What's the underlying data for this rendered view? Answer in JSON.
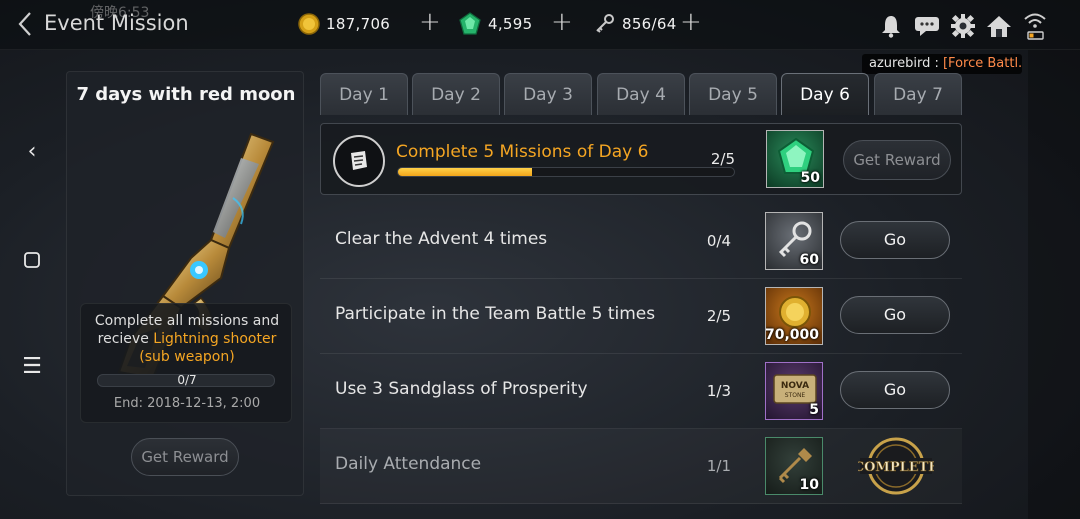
{
  "header": {
    "title": "Event Mission",
    "clock": "傍晚6:53",
    "gold": "187,706",
    "gems": "4,595",
    "keys": "856/64"
  },
  "chat": {
    "user": "azurebird",
    "sep": " : ",
    "message": "[Force Battl..."
  },
  "left_panel": {
    "title": "7 days with red moon",
    "desc_prefix": "Complete all missions and recieve ",
    "desc_highlight": "Lightning shooter (sub weapon)",
    "progress_text": "0/7",
    "progress": 0,
    "end": "End: 2018-12-13, 2:00",
    "button": "Get Reward"
  },
  "tabs": [
    "Day 1",
    "Day 2",
    "Day 3",
    "Day 4",
    "Day 5",
    "Day 6",
    "Day 7"
  ],
  "active_tab": "Day 6",
  "main_mission": {
    "title": "Complete 5 Missions of Day 6",
    "count": "2/5",
    "progress": 0.4,
    "reward_qty": "50",
    "button": "Get Reward"
  },
  "missions": [
    {
      "label": "Clear the Advent 4 times",
      "count": "0/4",
      "reward_qty": "60",
      "button": "Go"
    },
    {
      "label": "Participate in the Team Battle 5 times",
      "count": "2/5",
      "reward_qty": "70,000",
      "button": "Go"
    },
    {
      "label": "Use 3 Sandglass of Prosperity",
      "count": "1/3",
      "reward_qty": "5",
      "button": "Go"
    },
    {
      "label": "Daily Attendance",
      "count": "1/1",
      "reward_qty": "10",
      "status": "COMPLETE"
    }
  ],
  "reward_icons": {
    "nova": "NOVA",
    "nova_sub": "STONE"
  },
  "colors": {
    "accent": "#f5a623",
    "gem": "#2ecc71"
  }
}
